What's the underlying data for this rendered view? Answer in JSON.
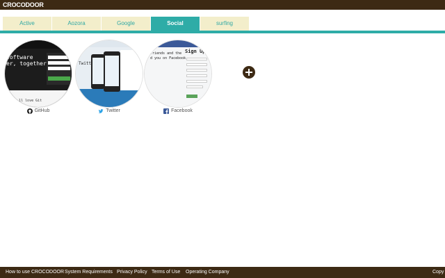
{
  "app": {
    "title": "CROCODOOR"
  },
  "tabs": [
    {
      "label": "Active",
      "active": false
    },
    {
      "label": "Aozora",
      "active": false
    },
    {
      "label": "Google",
      "active": false
    },
    {
      "label": "Social",
      "active": true
    },
    {
      "label": "surfing",
      "active": false
    }
  ],
  "sites": [
    {
      "label": "GitHub",
      "icon": "github-icon",
      "thumb": {
        "headline1": "software",
        "headline2": "er, together.",
        "quote": "' ll love Git"
      }
    },
    {
      "label": "Twitter",
      "icon": "twitter-icon",
      "thumb": {
        "heading": "Twitter."
      }
    },
    {
      "label": "Facebook",
      "icon": "facebook-icon",
      "thumb": {
        "signup": "Sign Up",
        "line1": "friends and the",
        "line2": "d you on Facebook."
      }
    }
  ],
  "add_button": {
    "icon": "plus-icon"
  },
  "footer": {
    "links": [
      "How to use CROCODOOR",
      "System Requirements",
      "Privacy Policy",
      "Terms of Use",
      "Operating Company"
    ],
    "copyright": "Copy"
  },
  "colors": {
    "brand_dark": "#3d2a14",
    "accent_teal": "#2eaca7",
    "tab_bg": "#f3eecb",
    "tab_text": "#30a8a4"
  }
}
